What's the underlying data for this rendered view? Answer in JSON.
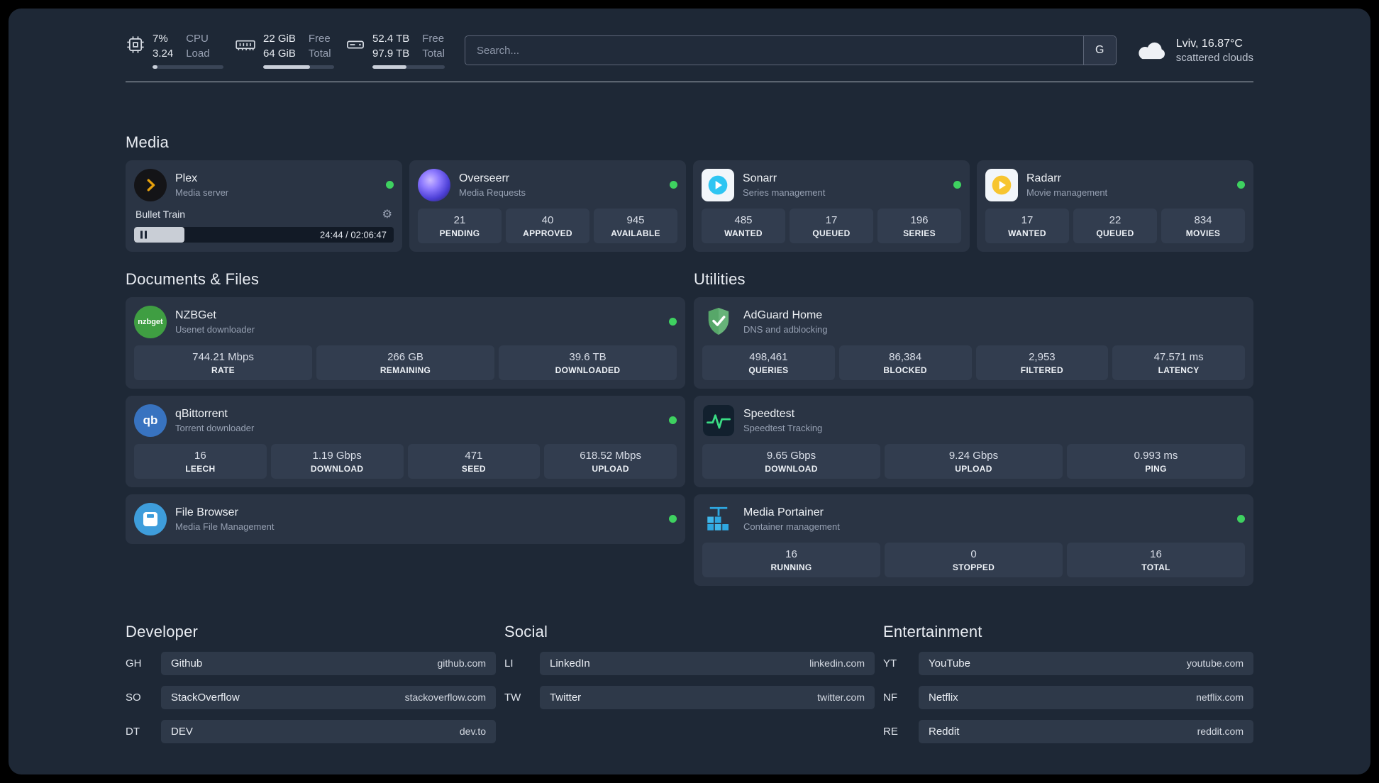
{
  "colors": {
    "status_online": "#3ed160",
    "plex_gold": "#e5a00d",
    "overseerr_purple": "#6c5ce7",
    "sonarr_blue": "#2ec5f2",
    "radarr_gold": "#f7c52f",
    "nzbget_green": "#3f9e42",
    "qbittorrent_blue": "#3873c0",
    "filebrowser_blue": "#3e9ddb",
    "adguard_green": "#67b379",
    "speedtest_green": "#3adc84",
    "portainer_blue": "#2ea7e0"
  },
  "icons": {
    "gear": "⚙",
    "qbittorrent_monogram": "qb",
    "nzbget_wordmark": "nzbget"
  },
  "topbar": {
    "cpu": {
      "percent": "7%",
      "load": "3.24",
      "label_top": "CPU",
      "label_bottom": "Load",
      "progress_pct": 7
    },
    "ram": {
      "free": "22 GiB",
      "total": "64 GiB",
      "label_top": "Free",
      "label_bottom": "Total",
      "progress_pct": 66
    },
    "disk": {
      "free": "52.4 TB",
      "total": "97.9 TB",
      "label_top": "Free",
      "label_bottom": "Total",
      "progress_pct": 47
    },
    "search": {
      "placeholder": "Search...",
      "engine_label": "G"
    },
    "weather": {
      "location": "Lviv, 16.87°C",
      "condition": "scattered clouds"
    }
  },
  "sections": {
    "media": {
      "heading": "Media",
      "plex": {
        "name": "Plex",
        "desc": "Media server",
        "now_playing": "Bullet Train",
        "time": "24:44 / 02:06:47",
        "progress_pct": 19.5
      },
      "overseerr": {
        "name": "Overseerr",
        "desc": "Media Requests",
        "stats": [
          {
            "value": "21",
            "label": "PENDING"
          },
          {
            "value": "40",
            "label": "APPROVED"
          },
          {
            "value": "945",
            "label": "AVAILABLE"
          }
        ]
      },
      "sonarr": {
        "name": "Sonarr",
        "desc": "Series management",
        "stats": [
          {
            "value": "485",
            "label": "WANTED"
          },
          {
            "value": "17",
            "label": "QUEUED"
          },
          {
            "value": "196",
            "label": "SERIES"
          }
        ]
      },
      "radarr": {
        "name": "Radarr",
        "desc": "Movie management",
        "stats": [
          {
            "value": "17",
            "label": "WANTED"
          },
          {
            "value": "22",
            "label": "QUEUED"
          },
          {
            "value": "834",
            "label": "MOVIES"
          }
        ]
      }
    },
    "documents": {
      "heading": "Documents & Files",
      "nzbget": {
        "name": "NZBGet",
        "desc": "Usenet downloader",
        "stats": [
          {
            "value": "744.21 Mbps",
            "label": "RATE"
          },
          {
            "value": "266 GB",
            "label": "REMAINING"
          },
          {
            "value": "39.6 TB",
            "label": "DOWNLOADED"
          }
        ]
      },
      "qbittorrent": {
        "name": "qBittorrent",
        "desc": "Torrent downloader",
        "stats": [
          {
            "value": "16",
            "label": "LEECH"
          },
          {
            "value": "1.19 Gbps",
            "label": "DOWNLOAD"
          },
          {
            "value": "471",
            "label": "SEED"
          },
          {
            "value": "618.52 Mbps",
            "label": "UPLOAD"
          }
        ]
      },
      "filebrowser": {
        "name": "File Browser",
        "desc": "Media File Management"
      }
    },
    "utilities": {
      "heading": "Utilities",
      "adguard": {
        "name": "AdGuard Home",
        "desc": "DNS and adblocking",
        "stats": [
          {
            "value": "498,461",
            "label": "QUERIES"
          },
          {
            "value": "86,384",
            "label": "BLOCKED"
          },
          {
            "value": "2,953",
            "label": "FILTERED"
          },
          {
            "value": "47.571 ms",
            "label": "LATENCY"
          }
        ]
      },
      "speedtest": {
        "name": "Speedtest",
        "desc": "Speedtest Tracking",
        "stats": [
          {
            "value": "9.65 Gbps",
            "label": "DOWNLOAD"
          },
          {
            "value": "9.24 Gbps",
            "label": "UPLOAD"
          },
          {
            "value": "0.993 ms",
            "label": "PING"
          }
        ]
      },
      "portainer": {
        "name": "Media Portainer",
        "desc": "Container management",
        "stats": [
          {
            "value": "16",
            "label": "RUNNING"
          },
          {
            "value": "0",
            "label": "STOPPED"
          },
          {
            "value": "16",
            "label": "TOTAL"
          }
        ]
      }
    },
    "bookmarks": {
      "developer": {
        "heading": "Developer",
        "items": [
          {
            "abbr": "GH",
            "name": "Github",
            "url": "github.com"
          },
          {
            "abbr": "SO",
            "name": "StackOverflow",
            "url": "stackoverflow.com"
          },
          {
            "abbr": "DT",
            "name": "DEV",
            "url": "dev.to"
          }
        ]
      },
      "social": {
        "heading": "Social",
        "items": [
          {
            "abbr": "LI",
            "name": "LinkedIn",
            "url": "linkedin.com"
          },
          {
            "abbr": "TW",
            "name": "Twitter",
            "url": "twitter.com"
          }
        ]
      },
      "entertainment": {
        "heading": "Entertainment",
        "items": [
          {
            "abbr": "YT",
            "name": "YouTube",
            "url": "youtube.com"
          },
          {
            "abbr": "NF",
            "name": "Netflix",
            "url": "netflix.com"
          },
          {
            "abbr": "RE",
            "name": "Reddit",
            "url": "reddit.com"
          }
        ]
      }
    }
  }
}
